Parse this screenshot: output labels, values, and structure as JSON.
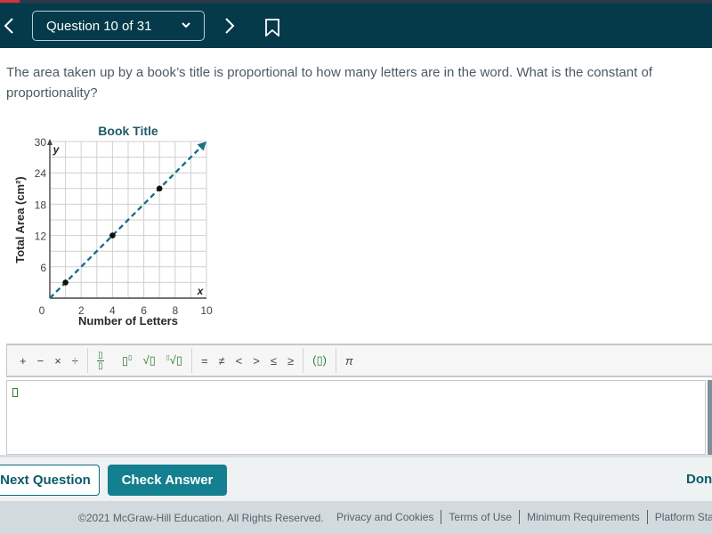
{
  "header": {
    "back_icon": "chevron-left-icon",
    "question_selector": "Question 10 of 31",
    "dropdown_icon": "chevron-down-icon",
    "next_icon": "chevron-right-icon",
    "bookmark_icon": "bookmark-icon",
    "colors": {
      "background": "#043a4a",
      "accent_strip": "#d0343a"
    }
  },
  "question": {
    "text": "The area taken up by a book’s title is proportional to how many letters are in the word. What is the constant of proportionality?"
  },
  "chart_data": {
    "type": "line",
    "title": "Book Title",
    "xlabel": "Number of Letters",
    "ylabel": "Total Area (cm²)",
    "x_axis_var": "x",
    "y_axis_var": "y",
    "xlim": [
      0,
      10
    ],
    "ylim": [
      0,
      30
    ],
    "x_ticks": [
      "0",
      "2",
      "4",
      "6",
      "8",
      "10"
    ],
    "y_ticks": [
      "6",
      "12",
      "18",
      "24",
      "30"
    ],
    "grid": true,
    "grid_step_x": 1,
    "grid_step_y": 3,
    "series": [
      {
        "name": "proportional line",
        "style": "dashed-arrow",
        "color": "#1a7088",
        "x": [
          0,
          10
        ],
        "y": [
          0,
          30
        ]
      },
      {
        "name": "points",
        "style": "markers",
        "color": "#111111",
        "x": [
          1,
          4,
          7
        ],
        "y": [
          3,
          12,
          21
        ]
      }
    ]
  },
  "toolbar": {
    "items": [
      {
        "name": "plus",
        "label": "+"
      },
      {
        "name": "minus",
        "label": "−"
      },
      {
        "name": "times",
        "label": "×"
      },
      {
        "name": "divide",
        "label": "÷"
      },
      {
        "name": "fraction",
        "label": "fraction"
      },
      {
        "name": "exponent",
        "label": "▯▯"
      },
      {
        "name": "square-root",
        "label": "√▯"
      },
      {
        "name": "nth-root",
        "label": "∜▯"
      },
      {
        "name": "equals",
        "label": "="
      },
      {
        "name": "not-equal",
        "label": "≠"
      },
      {
        "name": "less-than",
        "label": "<"
      },
      {
        "name": "greater-than",
        "label": ">"
      },
      {
        "name": "less-equal",
        "label": "≤"
      },
      {
        "name": "greater-equal",
        "label": "≥"
      },
      {
        "name": "parentheses",
        "label": "(▯)"
      },
      {
        "name": "pi",
        "label": "π"
      }
    ],
    "fraction_glyph": "▯",
    "exponent_base": "▯",
    "exponent_power": "▯",
    "sqrt_label": "√▯",
    "nroot_index": "▯",
    "nroot_label": "√▯",
    "paren_label": "(▯)"
  },
  "answer": {
    "value": ""
  },
  "actions": {
    "next_question": "Next Question",
    "check_answer": "Check Answer",
    "done": "Done"
  },
  "footer": {
    "copyright": "©2021 McGraw-Hill Education. All Rights Reserved.",
    "links": [
      "Privacy and Cookies",
      "Terms of Use",
      "Minimum Requirements",
      "Platform Status"
    ]
  }
}
